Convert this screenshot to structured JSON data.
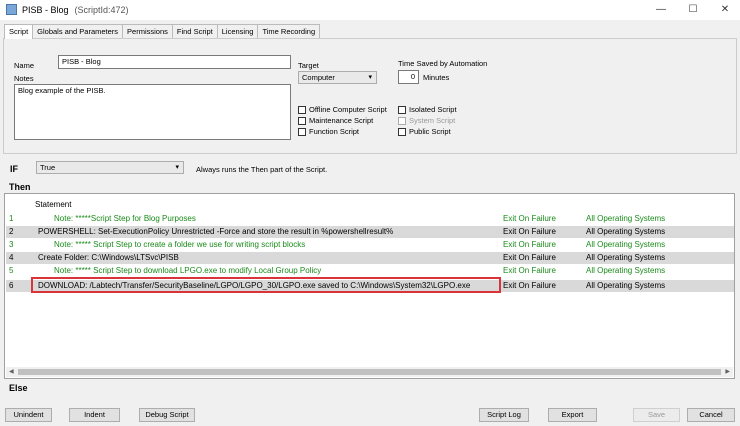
{
  "window": {
    "title": "PISB - Blog",
    "script_id": "(ScriptId:472)",
    "minimize": "—",
    "maximize": "☐",
    "close": "✕",
    "icon": "script-app-icon"
  },
  "tabs": [
    "Script",
    "Globals and Parameters",
    "Permissions",
    "Find Script",
    "Licensing",
    "Time Recording"
  ],
  "form": {
    "name_label": "Name",
    "name_value": "PISB - Blog",
    "notes_label": "Notes",
    "notes_value": "Blog example of the PISB.",
    "target_label": "Target",
    "target_value": "Computer",
    "time_saved_label": "Time Saved by Automation",
    "time_saved_value": "0",
    "minutes_label": "Minutes",
    "checkboxes": {
      "offline": "Offline Computer Script",
      "maintenance": "Maintenance Script",
      "function": "Function Script",
      "isolated": "Isolated Script",
      "system": "System Script",
      "public": "Public Script"
    }
  },
  "if_section": {
    "label": "IF",
    "condition": "True",
    "description": "Always runs the Then part of the Script."
  },
  "then_section": {
    "label": "Then",
    "header": "Statement",
    "rows": [
      {
        "num": "1",
        "stmt": "Note: *****Script Step for Blog Purposes",
        "exit": "Exit On Failure",
        "os": "All Operating Systems"
      },
      {
        "num": "2",
        "stmt": "POWERSHELL:  Set-ExecutionPolicy Unrestricted -Force and store the result in %powershellresult%",
        "exit": "Exit On Failure",
        "os": "All Operating Systems"
      },
      {
        "num": "3",
        "stmt": "Note: ***** Script Step to create a folder we use for writing script blocks",
        "exit": "Exit On Failure",
        "os": "All Operating Systems"
      },
      {
        "num": "4",
        "stmt": "Create Folder: C:\\Windows\\LTSvc\\PISB",
        "exit": "Exit On Failure",
        "os": "All Operating Systems"
      },
      {
        "num": "5",
        "stmt": "Note: ***** Script Step to download LPGO.exe to modify Local Group Policy",
        "exit": "Exit On Failure",
        "os": "All Operating Systems"
      },
      {
        "num": "6",
        "stmt": "DOWNLOAD:  /Labtech/Transfer/SecurityBaseline/LGPO/LGPO_30/LGPO.exe  saved to  C:\\Windows\\System32\\LGPO.exe",
        "exit": "Exit On Failure",
        "os": "All Operating Systems"
      }
    ]
  },
  "else_section": {
    "label": "Else"
  },
  "scrollbar": {
    "left": "◀",
    "right": "▶"
  },
  "buttons": {
    "unindent": "Unindent",
    "indent": "Indent",
    "debug": "Debug Script",
    "script_log": "Script Log",
    "export": "Export",
    "save": "Save",
    "cancel": "Cancel"
  },
  "colors": {
    "note_green": "#1a8a1a",
    "highlight_red": "#d9343a",
    "row_gray": "#d9d9d9"
  }
}
